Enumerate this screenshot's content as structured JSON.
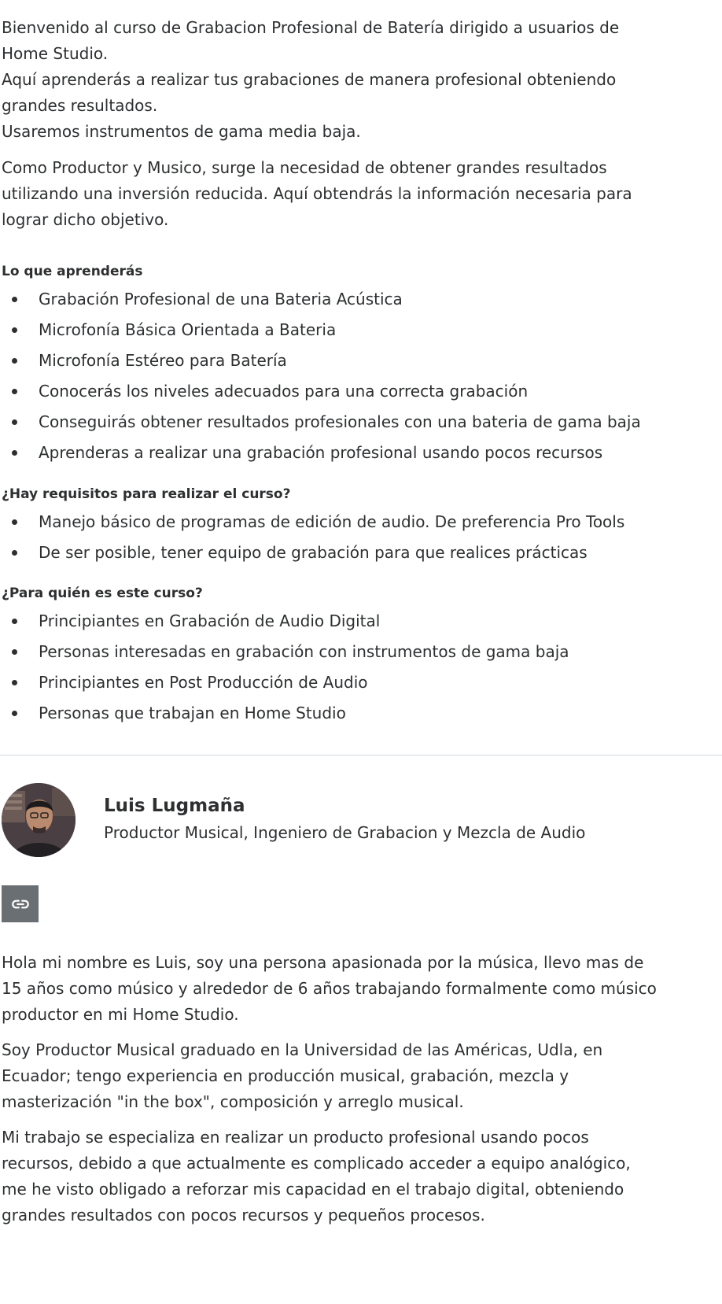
{
  "intro": {
    "lines": [
      "Bienvenido al curso de Grabacion Profesional de Batería dirigido a usuarios de",
      "Home Studio.",
      "Aquí aprenderás a realizar tus grabaciones de manera profesional obteniendo",
      "grandes resultados.",
      "Usaremos instrumentos de gama media baja."
    ],
    "para2_lines": [
      "Como Productor y Musico, surge la necesidad de obtener grandes resultados",
      "utilizando una inversión reducida. Aquí obtendrás la información necesaria para",
      "lograr dicho objetivo."
    ]
  },
  "learn": {
    "heading": "Lo que aprenderás",
    "items": [
      "Grabación Profesional de una Bateria Acústica",
      "Microfonía Básica Orientada a Bateria",
      "Microfonía Estéreo para Batería",
      "Conocerás los niveles adecuados para una correcta grabación",
      "Conseguirás obtener resultados profesionales con una bateria de gama baja",
      "Aprenderas a realizar una grabación profesional usando pocos recursos"
    ]
  },
  "requirements": {
    "heading": "¿Hay requisitos para realizar el curso?",
    "items": [
      "Manejo básico de programas de edición de audio. De preferencia Pro Tools",
      "De ser posible, tener equipo de grabación para que realices prácticas"
    ]
  },
  "audience": {
    "heading": "¿Para quién es este curso?",
    "items": [
      "Principiantes en Grabación de Audio Digital",
      "Personas interesadas en grabación con instrumentos de gama baja",
      "Principiantes en Post Producción de Audio",
      "Personas que trabajan en Home Studio"
    ]
  },
  "instructor": {
    "name": "Luis Lugmaña",
    "title": "Productor Musical, Ingeniero de Grabacion y Mezcla de Audio",
    "link_icon": "link-icon",
    "bio1_lines": [
      "Hola mi nombre es Luis, soy una persona apasionada por la música, llevo mas de",
      "15 años como músico y alrededor de 6 años trabajando formalmente como músico",
      "productor en mi Home Studio."
    ],
    "bio2_lines": [
      "Soy Productor Musical graduado en la Universidad de las Américas, Udla, en",
      "Ecuador; tengo experiencia en producción musical, grabación, mezcla y",
      "masterización \"in the box\", composición y arreglo musical."
    ],
    "bio3_lines": [
      "Mi trabajo se especializa en realizar un producto profesional usando pocos",
      "recursos, debido a que actualmente es complicado acceder a equipo analógico,",
      "me he visto obligado a reforzar mis capacidad en el trabajo digital, obteniendo",
      "grandes resultados con pocos recursos y pequeños procesos."
    ]
  },
  "colors": {
    "text": "#2d2f31",
    "divider": "#d1d7dc",
    "link_button": "#6a6f73"
  }
}
